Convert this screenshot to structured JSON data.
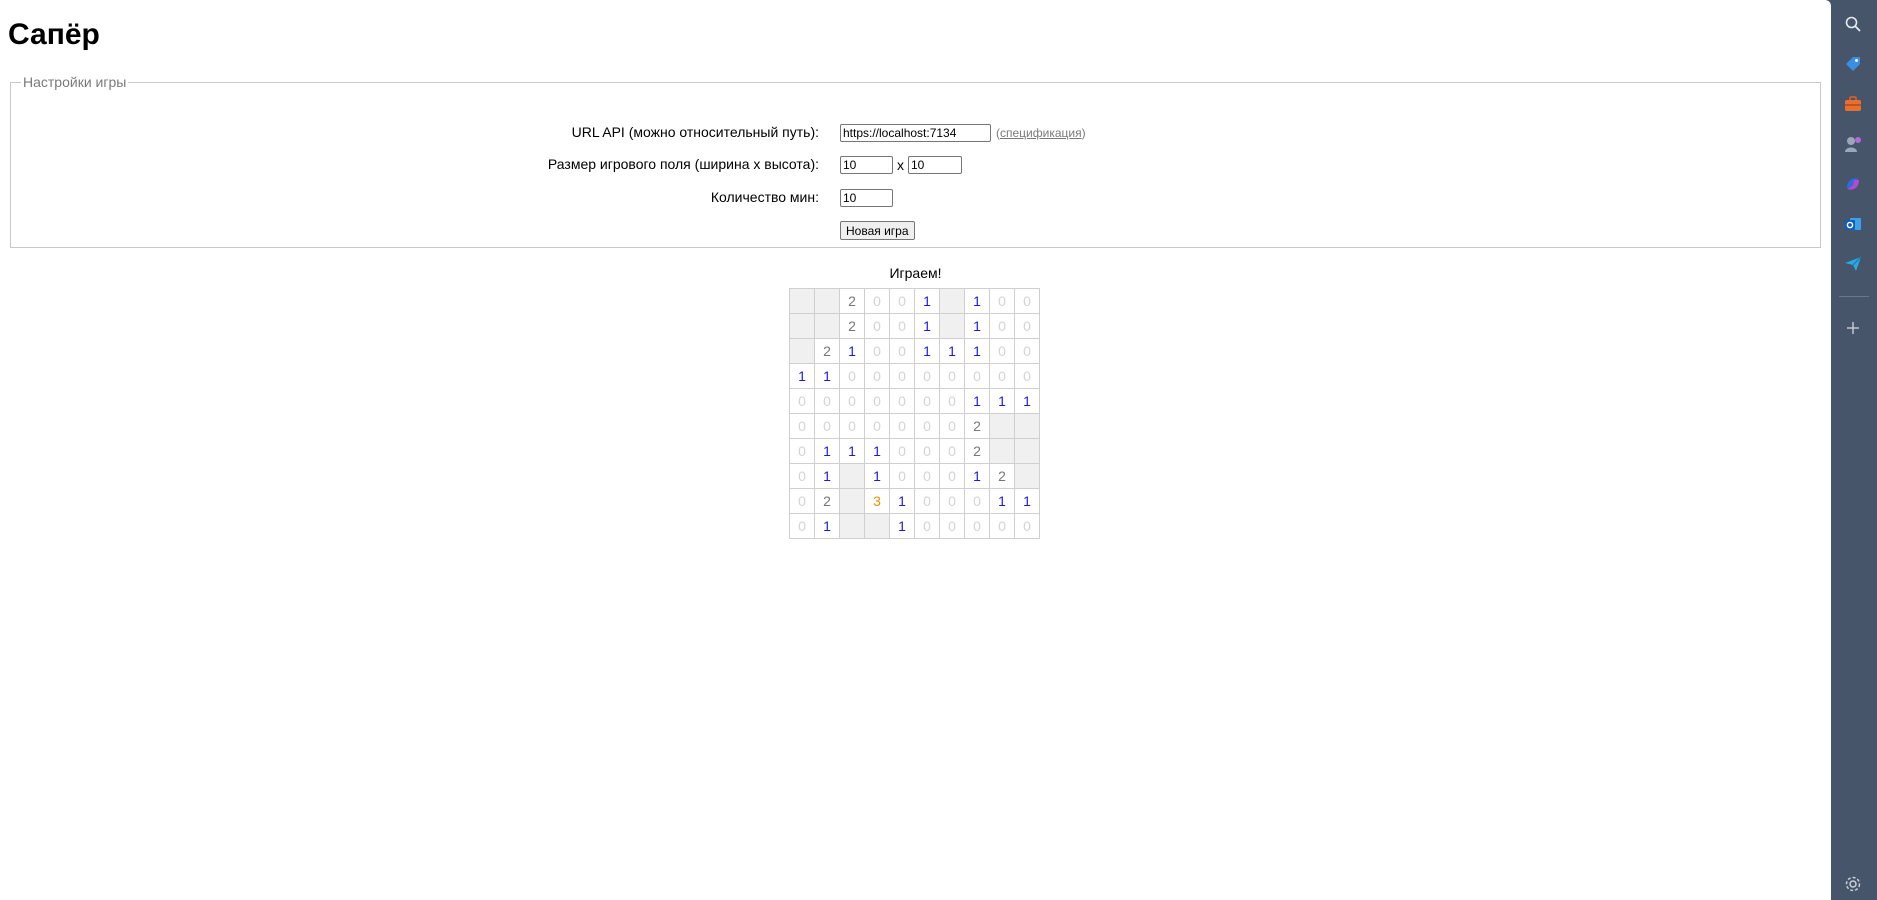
{
  "title": "Сапёр",
  "settings": {
    "legend": "Настройки игры",
    "api_label": "URL API (можно относительный путь):",
    "api_value": "https://localhost:7134",
    "spec_open": "(",
    "spec_link": "спецификация",
    "spec_close": ")",
    "size_label": "Размер игрового поля (ширина x высота):",
    "width_value": "10",
    "size_separator": "x",
    "height_value": "10",
    "mines_label": "Количество мин:",
    "mines_value": "10",
    "new_game_label": "Новая игра"
  },
  "status": "Играем!",
  "board": [
    [
      " ",
      " ",
      "2",
      "0",
      "0",
      "1",
      " ",
      "1",
      "0",
      "0"
    ],
    [
      " ",
      " ",
      "2",
      "0",
      "0",
      "1",
      " ",
      "1",
      "0",
      "0"
    ],
    [
      " ",
      "2",
      "1",
      "0",
      "0",
      "1",
      "1",
      "1",
      "0",
      "0"
    ],
    [
      "1",
      "1",
      "0",
      "0",
      "0",
      "0",
      "0",
      "0",
      "0",
      "0"
    ],
    [
      "0",
      "0",
      "0",
      "0",
      "0",
      "0",
      "0",
      "1",
      "1",
      "1"
    ],
    [
      "0",
      "0",
      "0",
      "0",
      "0",
      "0",
      "0",
      "2",
      " ",
      " "
    ],
    [
      "0",
      "1",
      "1",
      "1",
      "0",
      "0",
      "0",
      "2",
      " ",
      " "
    ],
    [
      "0",
      "1",
      " ",
      "1",
      "0",
      "0",
      "0",
      "1",
      "2",
      " "
    ],
    [
      "0",
      "2",
      " ",
      "3",
      "1",
      "0",
      "0",
      "0",
      "1",
      "1"
    ],
    [
      "0",
      "1",
      " ",
      " ",
      "1",
      "0",
      "0",
      "0",
      "0",
      "0"
    ]
  ],
  "colors": {
    "one": "#1a1adf",
    "two": "#777777",
    "three": "#ee8f00",
    "zero": "#d4d4d4",
    "closed_cell": "#f0f0f0",
    "rail": "#47556a"
  },
  "rail_icons": [
    "search-icon",
    "tag-icon",
    "briefcase-icon",
    "games-icon",
    "copilot-icon",
    "outlook-icon",
    "send-icon",
    "add-icon",
    "settings-icon"
  ]
}
